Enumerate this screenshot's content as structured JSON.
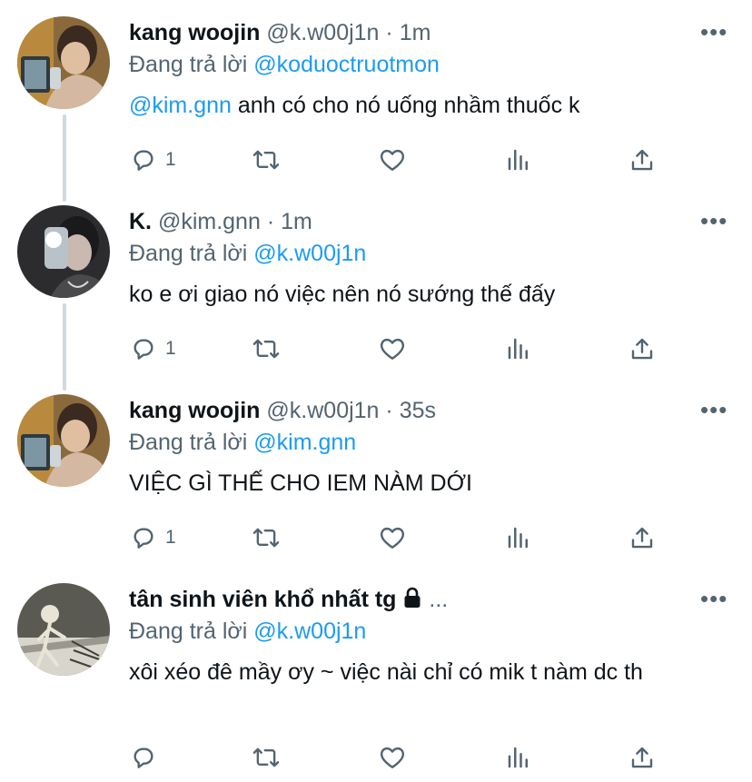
{
  "colors": {
    "link": "#1d9bf0",
    "muted": "#536471",
    "text": "#0f1419",
    "thread_line": "#cfd9de"
  },
  "tweets": [
    {
      "name": "kang woojin",
      "handle": "@k.w00j1n",
      "sep": "·",
      "time": "1m",
      "reply_prefix": "Đang trả lời ",
      "reply_to": "@koduoctruotmon",
      "mention": "@kim.gnn",
      "text": " anh có cho nó uống nhầm thuốc k",
      "reply_count": "1",
      "more_icon": "more-options-icon"
    },
    {
      "name": "K.",
      "handle": "@kim.gnn",
      "sep": "·",
      "time": "1m",
      "reply_prefix": "Đang trả lời ",
      "reply_to": "@k.w00j1n",
      "mention": "",
      "text": "ko e ơi giao nó việc nên nó sướng thế đấy",
      "reply_count": "1",
      "more_icon": "more-options-icon"
    },
    {
      "name": "kang woojin",
      "handle": "@k.w00j1n",
      "sep": "·",
      "time": "35s",
      "reply_prefix": "Đang trả lời ",
      "reply_to": "@kim.gnn",
      "mention": "",
      "text": "VIỆC GÌ THẾ CHO IEM NÀM DỚI",
      "reply_count": "1",
      "more_icon": "more-options-icon"
    },
    {
      "name": "tân sinh viên khổ nhất tg",
      "handle": "",
      "sep": "",
      "time": "",
      "ellipsis": "...",
      "reply_prefix": "Đang trả lời ",
      "reply_to": "@k.w00j1n",
      "mention": "",
      "text": "xôi xéo đê mầy ơy ~ việc nài chỉ có mik t nàm dc th",
      "reply_count": "",
      "more_icon": "more-options-icon"
    }
  ],
  "action_icons": [
    "reply-icon",
    "retweet-icon",
    "like-icon",
    "views-icon",
    "share-icon"
  ],
  "more_glyph": "•••"
}
